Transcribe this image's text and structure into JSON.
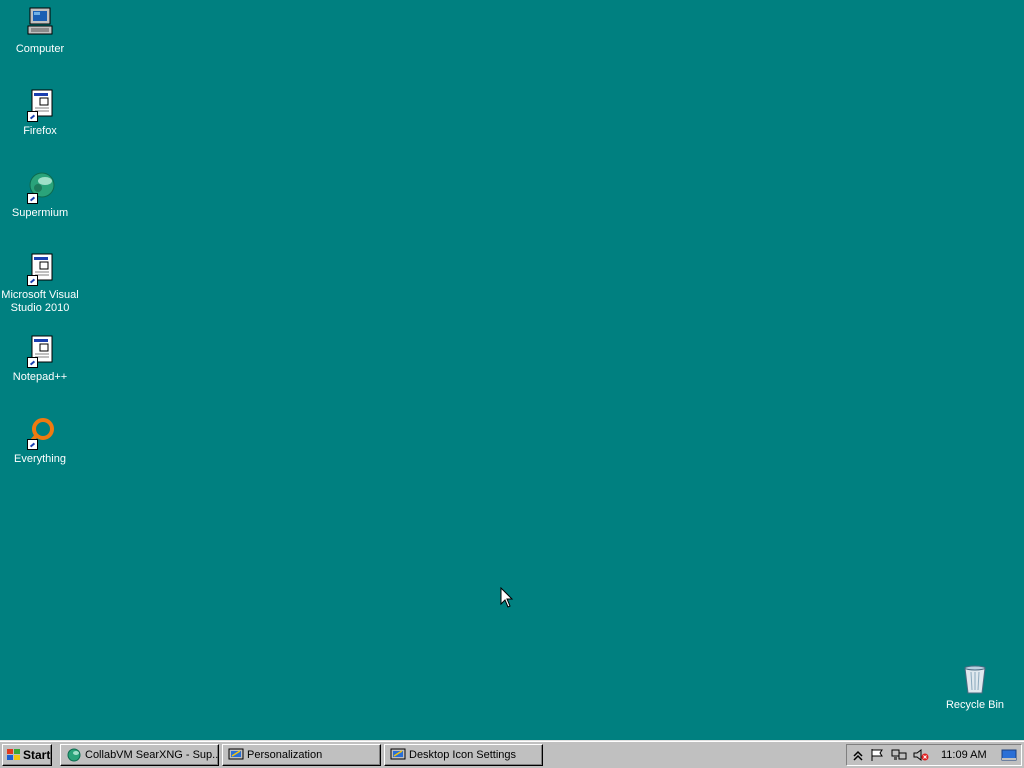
{
  "desktop": {
    "background": "#008080",
    "icons": [
      {
        "label": "Computer",
        "icon": "computer-icon"
      },
      {
        "label": "Firefox",
        "icon": "shortcut-document-icon"
      },
      {
        "label": "Supermium",
        "icon": "supermium-icon"
      },
      {
        "label": "Microsoft Visual Studio 2010",
        "icon": "shortcut-document-icon"
      },
      {
        "label": "Notepad++",
        "icon": "shortcut-document-icon"
      },
      {
        "label": "Everything",
        "icon": "everything-icon"
      },
      {
        "label": "Recycle Bin",
        "icon": "recycle-bin-icon"
      }
    ]
  },
  "taskbar": {
    "start_label": "Start",
    "tasks": [
      {
        "label": "CollabVM SearXNG - Sup...",
        "icon": "supermium-icon"
      },
      {
        "label": "Personalization",
        "icon": "personalization-icon"
      },
      {
        "label": "Desktop Icon Settings",
        "icon": "personalization-icon"
      }
    ],
    "tray": {
      "icons": [
        "show-hidden-icons-icon",
        "action-center-flag-icon",
        "network-icon",
        "volume-muted-icon"
      ],
      "clock": "11:09 AM"
    }
  }
}
